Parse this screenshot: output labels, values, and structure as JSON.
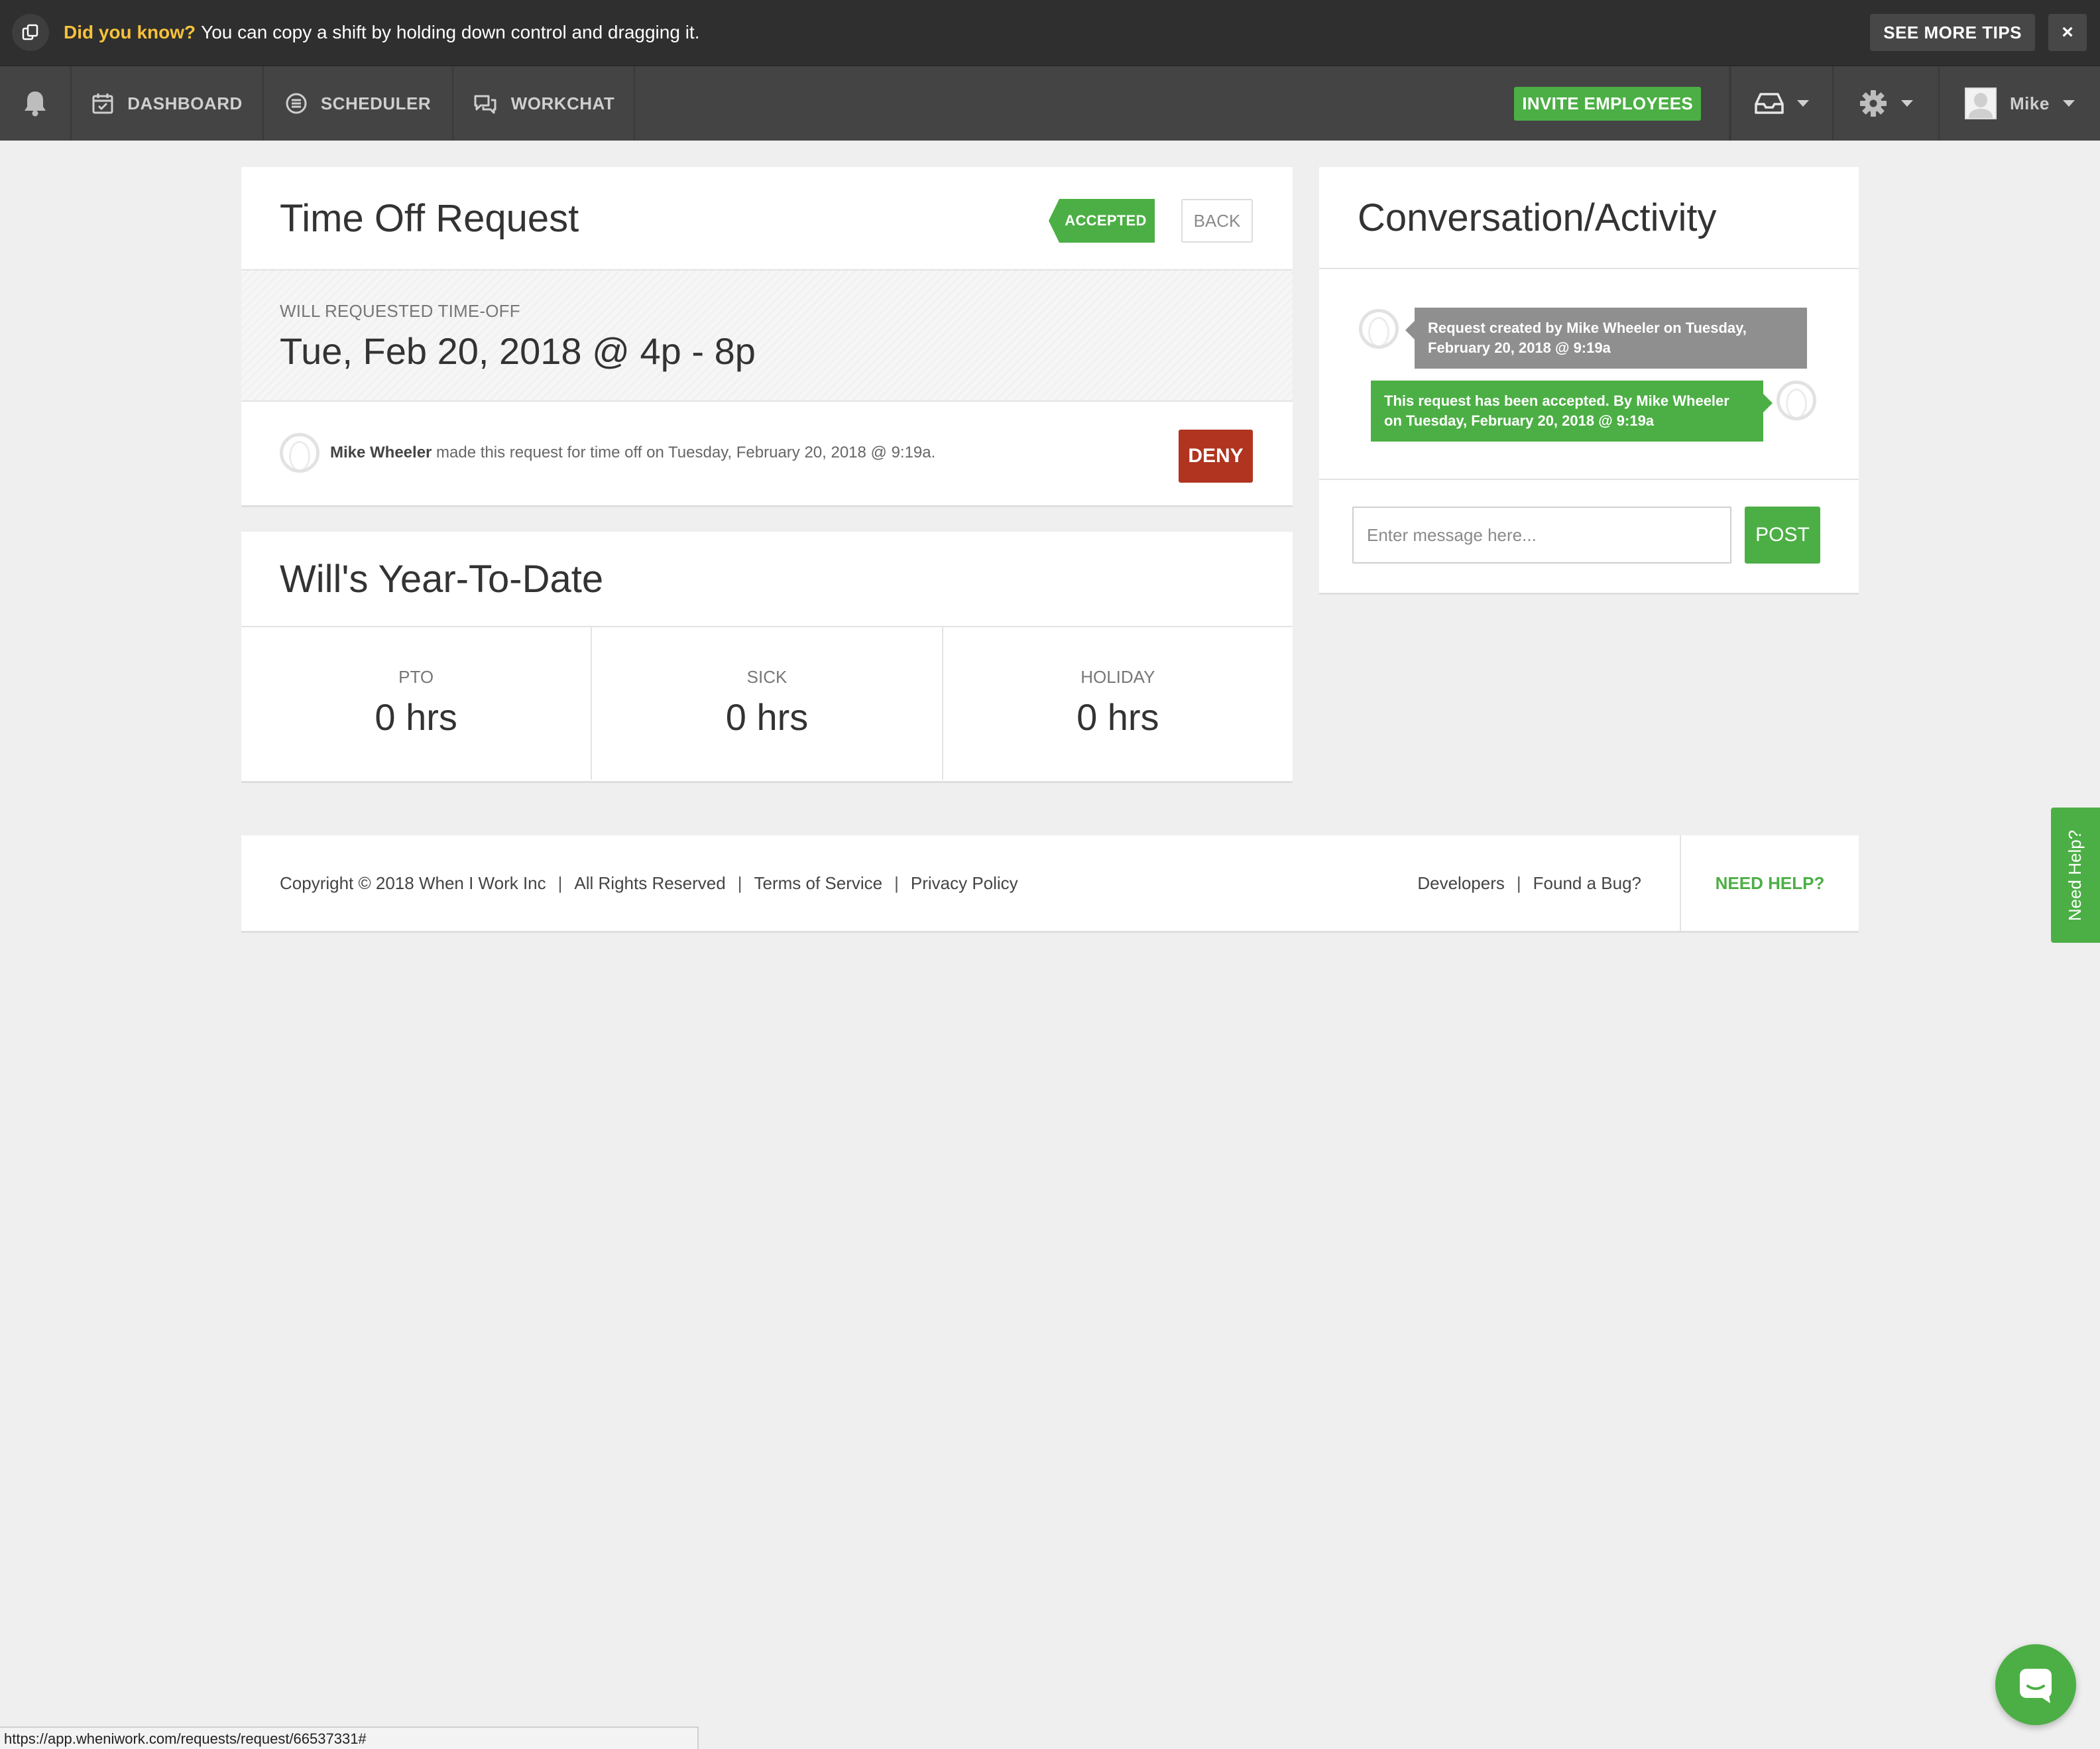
{
  "tipbar": {
    "label": "Did you know?",
    "text": "You can copy a shift by holding down control and dragging it.",
    "see_more": "SEE MORE TIPS",
    "close": "×"
  },
  "nav": {
    "items": [
      {
        "label": "DASHBOARD",
        "icon": "calendar-icon"
      },
      {
        "label": "SCHEDULER",
        "icon": "scheduler-icon"
      },
      {
        "label": "WORKCHAT",
        "icon": "chat-icon"
      }
    ],
    "invite": "INVITE EMPLOYEES",
    "user": "Mike"
  },
  "request": {
    "title": "Time Off Request",
    "status": "ACCEPTED",
    "back": "BACK",
    "range_label": "WILL REQUESTED TIME-OFF",
    "range_value": "Tue, Feb 20, 2018 @ 4p - 8p",
    "requester": "Mike Wheeler",
    "meta": " made this request for time off on Tuesday, February 20, 2018 @ 9:19a.",
    "deny": "DENY"
  },
  "ytd": {
    "title": "Will's Year-To-Date",
    "stats": [
      {
        "label": "PTO",
        "value": "0 hrs"
      },
      {
        "label": "SICK",
        "value": "0 hrs"
      },
      {
        "label": "HOLIDAY",
        "value": "0 hrs"
      }
    ]
  },
  "conversation": {
    "title": "Conversation/Activity",
    "messages": [
      {
        "text": "Request created by Mike Wheeler on Tuesday, February 20, 2018 @ 9:19a"
      },
      {
        "text": "This request has been accepted. By Mike Wheeler on Tuesday, February 20, 2018 @ 9:19a"
      }
    ],
    "input_placeholder": "Enter message here...",
    "post": "POST"
  },
  "footer": {
    "copyright": "Copyright © 2018 When I Work Inc",
    "rights": "All Rights Reserved",
    "terms": "Terms of Service",
    "privacy": "Privacy Policy",
    "developers": "Developers",
    "bug": "Found a Bug?",
    "need_help": "NEED HELP?"
  },
  "side_help": "Need Help?",
  "status_url": "https://app.wheniwork.com/requests/request/66537331#",
  "colors": {
    "brand_green": "#4caf45",
    "deny_red": "#b0341f",
    "tip_yellow": "#f6c23b",
    "navbar": "#444444"
  }
}
